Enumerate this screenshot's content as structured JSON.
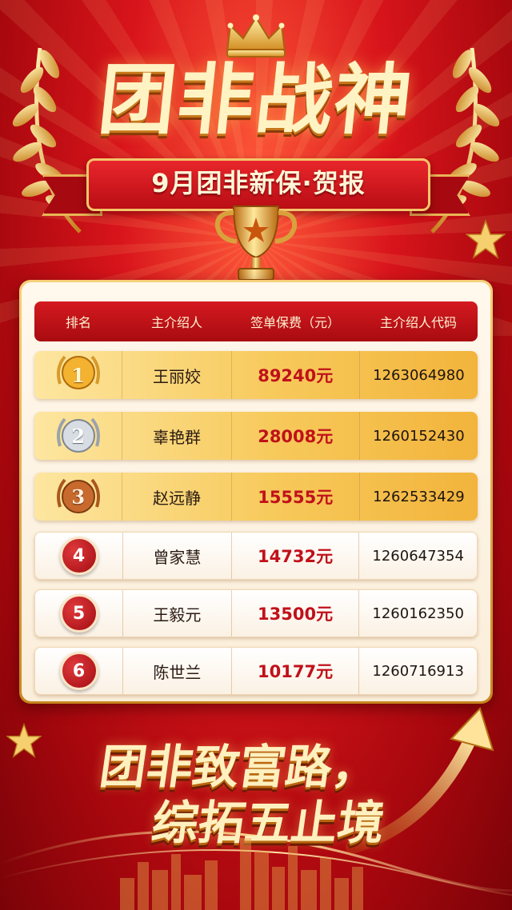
{
  "header": {
    "title": "团非战神",
    "subtitle": "9月团非新保·贺报"
  },
  "table": {
    "columns": [
      "排名",
      "主介绍人",
      "签单保费（元）",
      "主介绍人代码"
    ],
    "rows": [
      {
        "rank": "1",
        "name": "王丽姣",
        "amount": "89240元",
        "code": "1263064980",
        "style": "gold",
        "medal": "gold"
      },
      {
        "rank": "2",
        "name": "辜艳群",
        "amount": "28008元",
        "code": "1260152430",
        "style": "gold",
        "medal": "silver"
      },
      {
        "rank": "3",
        "name": "赵远静",
        "amount": "15555元",
        "code": "1262533429",
        "style": "gold",
        "medal": "bronze"
      },
      {
        "rank": "4",
        "name": "曾家慧",
        "amount": "14732元",
        "code": "1260647354",
        "style": "plain",
        "medal": "none"
      },
      {
        "rank": "5",
        "name": "王毅元",
        "amount": "13500元",
        "code": "1260162350",
        "style": "plain",
        "medal": "none"
      },
      {
        "rank": "6",
        "name": "陈世兰",
        "amount": "10177元",
        "code": "1260716913",
        "style": "plain",
        "medal": "none"
      }
    ]
  },
  "footer": {
    "slogan_line1": "团非致富路，",
    "slogan_line2": "综拓五止境"
  },
  "colors": {
    "background": "#d8141b",
    "gold": "#f2b43c",
    "amount_red": "#c0111a"
  }
}
